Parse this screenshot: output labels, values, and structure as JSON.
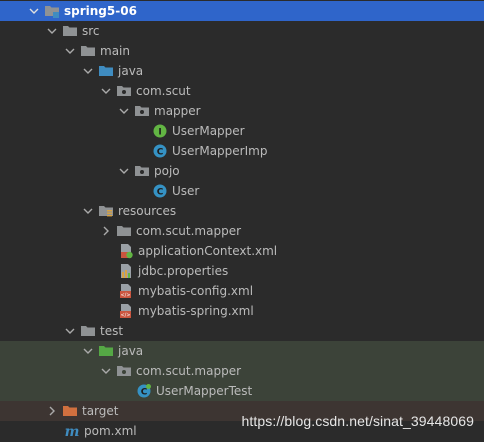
{
  "tree": {
    "project": "spring5-06",
    "src": "src",
    "main": "main",
    "java": "java",
    "com_scut": "com.scut",
    "mapper": "mapper",
    "user_mapper": "UserMapper",
    "user_mapper_imp": "UserMapperImp",
    "pojo": "pojo",
    "user": "User",
    "resources": "resources",
    "res_com_scut_mapper": "com.scut.mapper",
    "application_context": "applicationContext.xml",
    "jdbc_properties": "jdbc.properties",
    "mybatis_config": "mybatis-config.xml",
    "mybatis_spring": "mybatis-spring.xml",
    "test": "test",
    "test_java": "java",
    "test_com_scut_mapper": "com.scut.mapper",
    "user_mapper_test": "UserMapperTest",
    "target": "target",
    "pom": "pom.xml"
  },
  "watermark": "https://blog.csdn.net/sinat_39448069",
  "colors": {
    "background": "#2b2b2b",
    "selection": "#2f65ca",
    "folder": "#8f9294",
    "source_folder": "#3f8cc0",
    "test_folder": "#55a845",
    "excluded_folder": "#d0703f",
    "class_badge": "#3592c4",
    "interface_badge": "#62b543"
  }
}
